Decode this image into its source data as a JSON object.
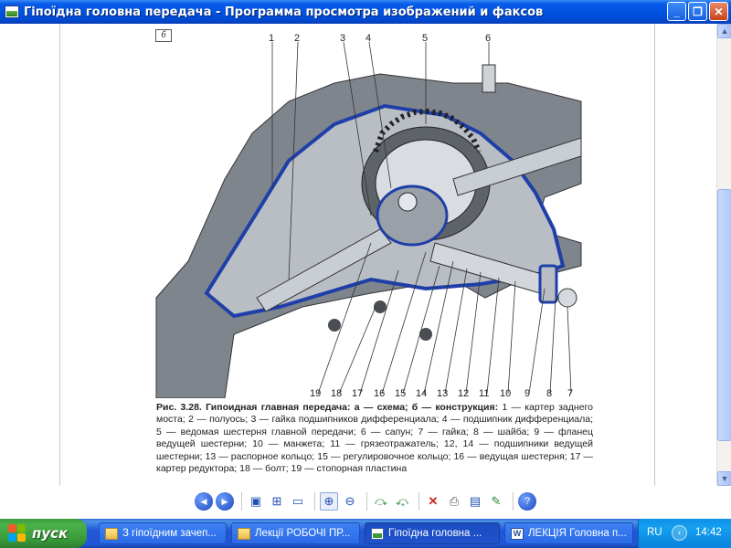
{
  "window": {
    "title": "Гіпоїдна головна передача - Программа просмотра изображений и факсов",
    "controls": [
      "minimize",
      "maximize",
      "close"
    ]
  },
  "figure": {
    "panel_label": "б",
    "callouts_top": [
      "1",
      "2",
      "3",
      "4",
      "5",
      "6"
    ],
    "callouts_bottom": [
      "19",
      "18",
      "17",
      "16",
      "15",
      "14",
      "13",
      "12",
      "11",
      "10",
      "9",
      "8",
      "7"
    ],
    "caption_head": "Рис. 3.28. Гипоидная главная передача: а — схема; б — конструкция:",
    "caption_body": " 1 — картер заднего моста; 2 — полуось; 3 — гайка подшипников дифференциала; 4 — подшипник дифференциала; 5 — ведомая шестерня главной передачи; 6 — сапун; 7 — гайка; 8 — шайба; 9 — фланец ведущей шестерни; 10 — манжета; 11 — грязеотражатель; 12, 14 — подшипники ведущей шестерни; 13 — распорное кольцо; 15 — регулировочное кольцо; 16 — ведущая шестерня; 17 — картер редуктора; 18 — болт; 19 — стопорная пластина",
    "colors": {
      "housing_outline": "#1f3fa8",
      "metal": "#8a8f96",
      "dark": "#3b3e44"
    }
  },
  "toolbar": {
    "tools": [
      "previous-image-icon",
      "next-image-icon",
      "best-fit-icon",
      "actual-size-icon",
      "slideshow-icon",
      "zoom-in-icon",
      "zoom-out-icon",
      "rotate-clockwise-icon",
      "rotate-counterclockwise-icon",
      "delete-icon",
      "print-icon",
      "save-icon",
      "edit-icon",
      "help-icon"
    ]
  },
  "taskbar": {
    "start_label": "пуск",
    "tasks": [
      {
        "label": "З гіпоїдним зачеп...",
        "icon": "folder-icon",
        "active": false
      },
      {
        "label": "Лекції РОБОЧІ ПР...",
        "icon": "folder-icon",
        "active": false
      },
      {
        "label": "Гіпоїдна головна ...",
        "icon": "image-viewer-icon",
        "active": true
      },
      {
        "label": "ЛЕКЦІЯ Головна п...",
        "icon": "word-document-icon",
        "active": false
      }
    ],
    "language": "RU",
    "clock": "14:42"
  }
}
